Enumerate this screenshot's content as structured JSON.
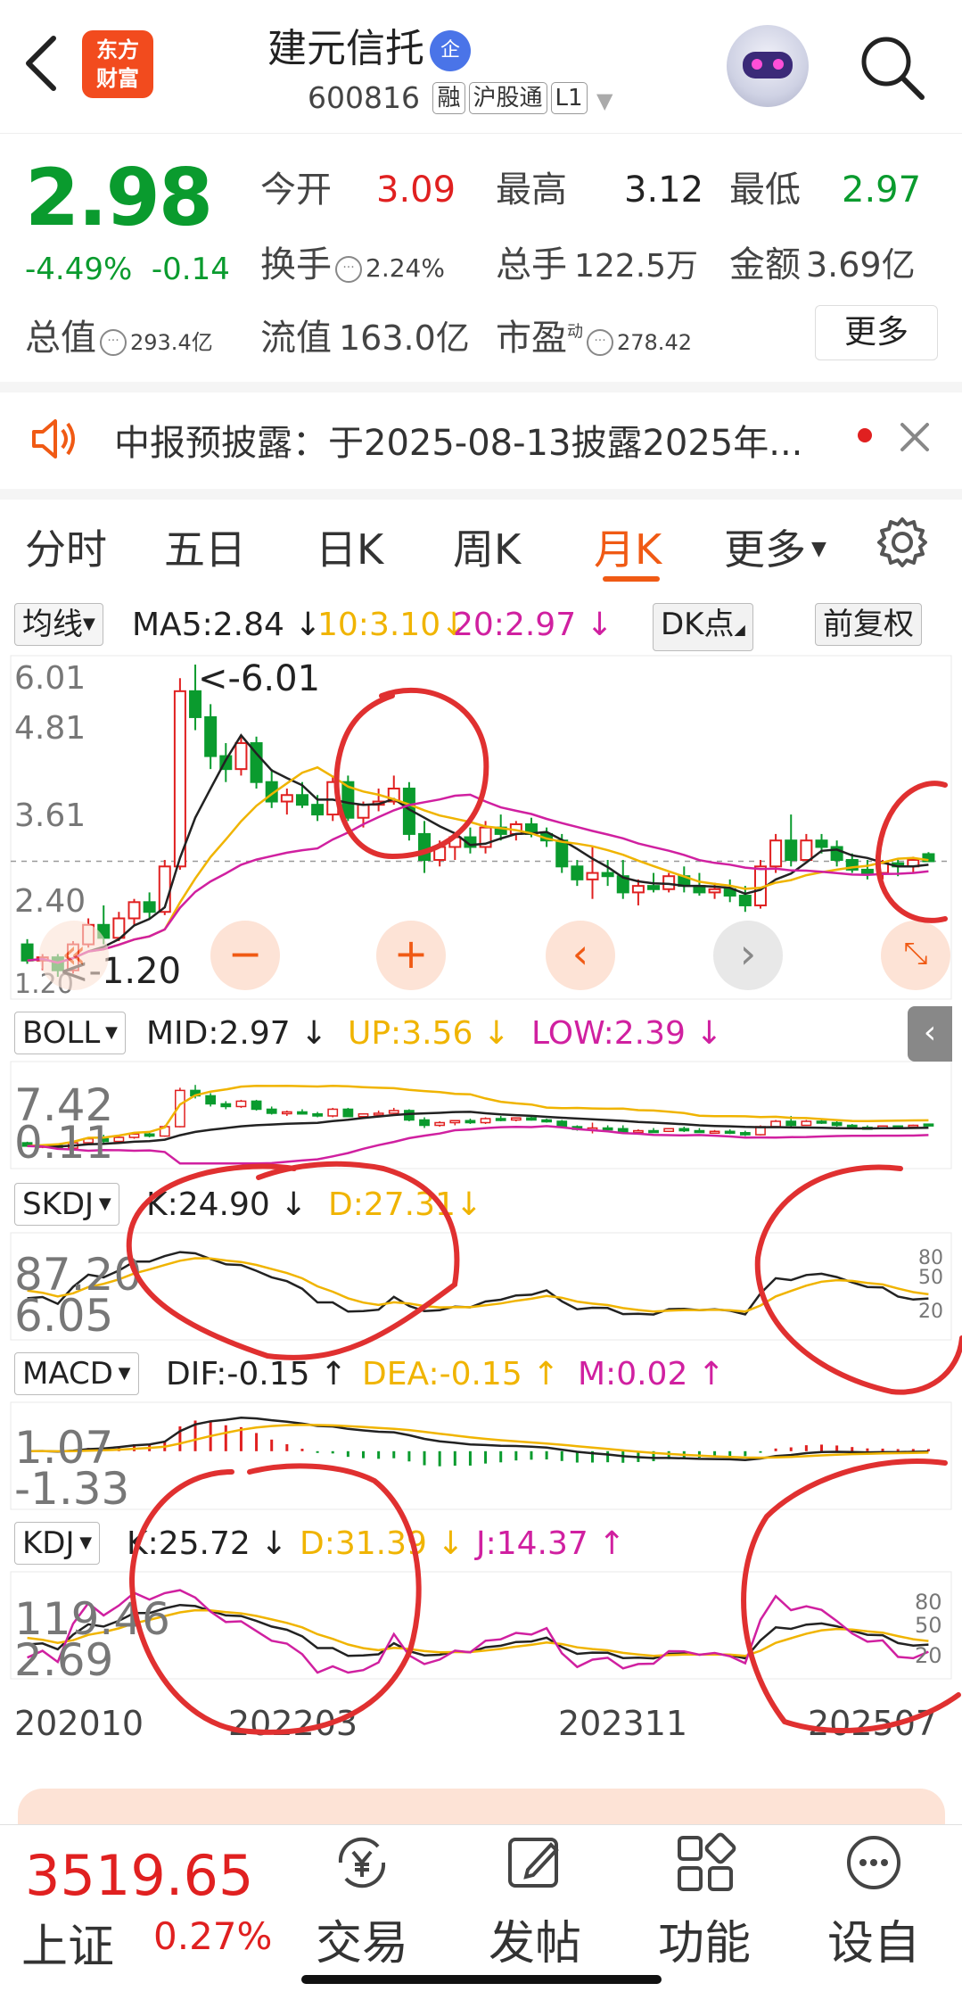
{
  "header": {
    "logo_text_line1": "东方",
    "logo_text_line2": "财富",
    "stock_name": "建元信托",
    "badge": "企",
    "stock_code": "600816",
    "tags": [
      "融",
      "沪股通",
      "L1"
    ]
  },
  "quote": {
    "price": "2.98",
    "change_pct": "-4.49%",
    "change_abs": "-0.14",
    "open_label": "今开",
    "open_value": "3.09",
    "high_label": "最高",
    "high_value": "3.12",
    "low_label": "最低",
    "low_value": "2.97",
    "turnover_label": "换手",
    "turnover_value": "2.24%",
    "volume_label": "总手",
    "volume_value": "122.5万",
    "amount_label": "金额",
    "amount_value": "3.69亿",
    "mktcap_label": "总值",
    "mktcap_value": "293.4亿",
    "float_label": "流值",
    "float_value": "163.0亿",
    "pe_label": "市盈",
    "pe_sup": "动",
    "pe_value": "278.42",
    "more_button": "更多"
  },
  "notice": {
    "text": "中报预披露：于2025-08-13披露2025年..."
  },
  "tabs": [
    "分时",
    "五日",
    "日K",
    "周K",
    "月K",
    "更多"
  ],
  "active_tab": "月K",
  "main_indicator": {
    "selector": "均线",
    "ma5": "MA5:2.84",
    "ma10": "10:3.10",
    "ma20": "20:2.97",
    "dk_button": "DK点",
    "fq_button": "前复权",
    "y_labels": [
      "6.01",
      "4.81",
      "3.61",
      "2.40",
      "1.20"
    ],
    "max_annotation": "<-6.01",
    "min_annotation": "<-1.20"
  },
  "boll": {
    "selector": "BOLL",
    "mid": "MID:2.97",
    "up": "UP:3.56",
    "low": "LOW:2.39",
    "y_labels": [
      "7.42",
      "0.11"
    ]
  },
  "skdj": {
    "selector": "SKDJ",
    "k": "K:24.90",
    "d": "D:27.31",
    "y_labels": [
      "87.20",
      "6.05"
    ],
    "right_labels": [
      "80",
      "50",
      "20"
    ]
  },
  "macd": {
    "selector": "MACD",
    "dif": "DIF:-0.15",
    "dea": "DEA:-0.15",
    "m": "M:0.02",
    "y_labels": [
      "1.07",
      "-1.33"
    ]
  },
  "kdj": {
    "selector": "KDJ",
    "k": "K:25.72",
    "d": "D:31.39",
    "j": "J:14.37",
    "y_labels": [
      "119.46",
      "2.69"
    ],
    "right_labels": [
      "80",
      "50",
      "20"
    ]
  },
  "x_axis": [
    "202010",
    "202203",
    "202311",
    "202507"
  ],
  "colors": {
    "up": "#e02020",
    "down": "#0a9b2e",
    "ma5": "#222222",
    "ma10": "#f0b400",
    "ma20": "#d020a0",
    "accent": "#f05a14"
  },
  "chart_data": {
    "type": "candlestick",
    "period": "monthly",
    "price_range": [
      1.2,
      6.01
    ],
    "candles": [
      {
        "o": 1.7,
        "h": 1.78,
        "l": 1.4,
        "c": 1.45
      },
      {
        "o": 1.45,
        "h": 1.55,
        "l": 1.3,
        "c": 1.5
      },
      {
        "o": 1.5,
        "h": 1.55,
        "l": 1.2,
        "c": 1.3
      },
      {
        "o": 1.3,
        "h": 1.75,
        "l": 1.25,
        "c": 1.7
      },
      {
        "o": 1.7,
        "h": 2.1,
        "l": 1.65,
        "c": 2.0
      },
      {
        "o": 2.0,
        "h": 2.3,
        "l": 1.7,
        "c": 1.8
      },
      {
        "o": 1.8,
        "h": 2.2,
        "l": 1.75,
        "c": 2.1
      },
      {
        "o": 2.1,
        "h": 2.4,
        "l": 2.0,
        "c": 2.35
      },
      {
        "o": 2.35,
        "h": 2.5,
        "l": 2.1,
        "c": 2.2
      },
      {
        "o": 2.2,
        "h": 3.0,
        "l": 2.15,
        "c": 2.9
      },
      {
        "o": 2.9,
        "h": 5.8,
        "l": 2.85,
        "c": 5.6
      },
      {
        "o": 5.6,
        "h": 6.01,
        "l": 5.0,
        "c": 5.2
      },
      {
        "o": 5.2,
        "h": 5.4,
        "l": 4.4,
        "c": 4.6
      },
      {
        "o": 4.6,
        "h": 4.8,
        "l": 4.2,
        "c": 4.4
      },
      {
        "o": 4.4,
        "h": 4.9,
        "l": 4.3,
        "c": 4.8
      },
      {
        "o": 4.8,
        "h": 4.9,
        "l": 4.1,
        "c": 4.2
      },
      {
        "o": 4.2,
        "h": 4.4,
        "l": 3.8,
        "c": 3.9
      },
      {
        "o": 3.9,
        "h": 4.1,
        "l": 3.7,
        "c": 4.0
      },
      {
        "o": 4.0,
        "h": 4.2,
        "l": 3.8,
        "c": 3.85
      },
      {
        "o": 3.85,
        "h": 4.0,
        "l": 3.6,
        "c": 3.7
      },
      {
        "o": 3.7,
        "h": 4.3,
        "l": 3.6,
        "c": 4.2
      },
      {
        "o": 4.2,
        "h": 4.3,
        "l": 3.6,
        "c": 3.65
      },
      {
        "o": 3.65,
        "h": 3.9,
        "l": 3.5,
        "c": 3.85
      },
      {
        "o": 3.85,
        "h": 4.1,
        "l": 3.75,
        "c": 3.9
      },
      {
        "o": 3.9,
        "h": 4.3,
        "l": 3.85,
        "c": 4.1
      },
      {
        "o": 4.1,
        "h": 4.2,
        "l": 3.3,
        "c": 3.4
      },
      {
        "o": 3.4,
        "h": 3.6,
        "l": 2.8,
        "c": 3.0
      },
      {
        "o": 3.0,
        "h": 3.3,
        "l": 2.9,
        "c": 3.2
      },
      {
        "o": 3.2,
        "h": 3.4,
        "l": 3.0,
        "c": 3.35
      },
      {
        "o": 3.35,
        "h": 3.5,
        "l": 3.1,
        "c": 3.2
      },
      {
        "o": 3.2,
        "h": 3.6,
        "l": 3.1,
        "c": 3.5
      },
      {
        "o": 3.5,
        "h": 3.7,
        "l": 3.3,
        "c": 3.4
      },
      {
        "o": 3.4,
        "h": 3.6,
        "l": 3.3,
        "c": 3.55
      },
      {
        "o": 3.55,
        "h": 3.65,
        "l": 3.35,
        "c": 3.4
      },
      {
        "o": 3.4,
        "h": 3.5,
        "l": 3.2,
        "c": 3.3
      },
      {
        "o": 3.3,
        "h": 3.4,
        "l": 2.8,
        "c": 2.9
      },
      {
        "o": 2.9,
        "h": 3.0,
        "l": 2.6,
        "c": 2.7
      },
      {
        "o": 2.7,
        "h": 3.2,
        "l": 2.4,
        "c": 2.8
      },
      {
        "o": 2.8,
        "h": 3.0,
        "l": 2.6,
        "c": 2.75
      },
      {
        "o": 2.75,
        "h": 3.0,
        "l": 2.4,
        "c": 2.5
      },
      {
        "o": 2.5,
        "h": 2.7,
        "l": 2.3,
        "c": 2.6
      },
      {
        "o": 2.6,
        "h": 2.8,
        "l": 2.5,
        "c": 2.55
      },
      {
        "o": 2.55,
        "h": 2.8,
        "l": 2.5,
        "c": 2.75
      },
      {
        "o": 2.75,
        "h": 2.9,
        "l": 2.5,
        "c": 2.6
      },
      {
        "o": 2.6,
        "h": 2.8,
        "l": 2.45,
        "c": 2.5
      },
      {
        "o": 2.5,
        "h": 2.65,
        "l": 2.4,
        "c": 2.55
      },
      {
        "o": 2.55,
        "h": 2.7,
        "l": 2.35,
        "c": 2.45
      },
      {
        "o": 2.45,
        "h": 2.6,
        "l": 2.2,
        "c": 2.3
      },
      {
        "o": 2.3,
        "h": 3.0,
        "l": 2.25,
        "c": 2.9
      },
      {
        "o": 2.9,
        "h": 3.4,
        "l": 2.8,
        "c": 3.3
      },
      {
        "o": 3.3,
        "h": 3.7,
        "l": 2.9,
        "c": 3.0
      },
      {
        "o": 3.0,
        "h": 3.4,
        "l": 3.0,
        "c": 3.3
      },
      {
        "o": 3.3,
        "h": 3.4,
        "l": 3.1,
        "c": 3.2
      },
      {
        "o": 3.2,
        "h": 3.3,
        "l": 2.9,
        "c": 3.0
      },
      {
        "o": 3.0,
        "h": 3.1,
        "l": 2.8,
        "c": 2.85
      },
      {
        "o": 2.85,
        "h": 3.0,
        "l": 2.7,
        "c": 2.8
      },
      {
        "o": 2.8,
        "h": 3.0,
        "l": 2.7,
        "c": 2.95
      },
      {
        "o": 2.95,
        "h": 3.0,
        "l": 2.75,
        "c": 2.9
      },
      {
        "o": 2.9,
        "h": 3.05,
        "l": 2.8,
        "c": 3.0
      },
      {
        "o": 3.09,
        "h": 3.12,
        "l": 2.97,
        "c": 2.98
      }
    ],
    "ma5_last": 2.84,
    "ma10_last": 3.1,
    "ma20_last": 2.97,
    "boll": {
      "mid": 2.97,
      "up": 3.56,
      "low": 2.39,
      "range": [
        0.11,
        7.42
      ]
    },
    "skdj": {
      "k": 24.9,
      "d": 27.31,
      "range": [
        6.05,
        87.2
      ]
    },
    "macd": {
      "dif": -0.15,
      "dea": -0.15,
      "m": 0.02,
      "range": [
        -1.33,
        1.07
      ]
    },
    "kdj": {
      "k": 25.72,
      "d": 31.39,
      "j": 14.37,
      "range": [
        2.69,
        119.46
      ]
    }
  },
  "bottom": {
    "index_value": "3519.65",
    "index_name": "上证",
    "index_change": "0.27%",
    "nav": [
      {
        "label": "交易",
        "icon": "yen-exchange-icon"
      },
      {
        "label": "发帖",
        "icon": "edit-post-icon"
      },
      {
        "label": "功能",
        "icon": "grid-functions-icon"
      },
      {
        "label": "设自",
        "icon": "more-dots-icon"
      }
    ]
  }
}
